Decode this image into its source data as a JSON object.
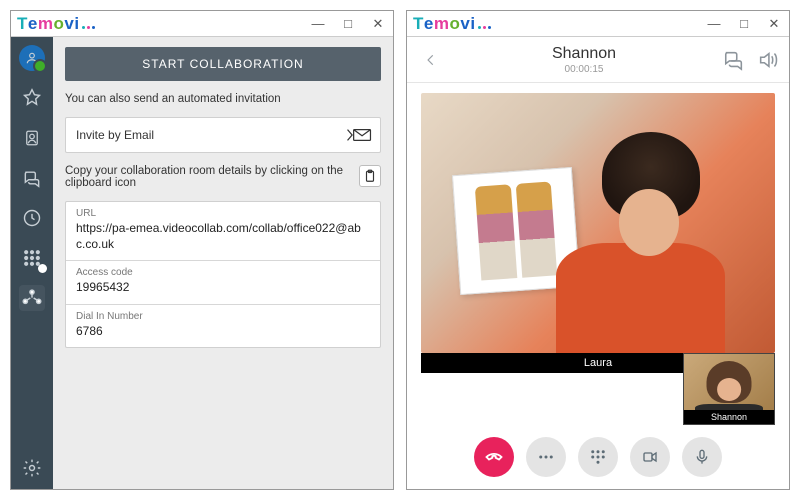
{
  "brand": {
    "t": "T",
    "e": "e",
    "m": "m",
    "o": "o",
    "vi": "vi"
  },
  "windowControls": {
    "minimize": "—",
    "maximize": "□",
    "close": "✕"
  },
  "collab": {
    "startButton": "START COLLABORATION",
    "inviteHint": "You can also send an automated invitation",
    "inviteByEmailLabel": "Invite by Email",
    "copyHint": "Copy your collaboration room details by clicking on the clipboard icon",
    "urlLabel": "URL",
    "urlValue": "https://pa-emea.videocollab.com/collab/office022@abc.co.uk",
    "accessCodeLabel": "Access code",
    "accessCodeValue": "19965432",
    "dialInLabel": "Dial In Number",
    "dialInValue": "6786"
  },
  "sidebar": {
    "items": [
      {
        "name": "avatar-status"
      },
      {
        "name": "favorites"
      },
      {
        "name": "contacts"
      },
      {
        "name": "chats"
      },
      {
        "name": "history"
      },
      {
        "name": "dialpad"
      },
      {
        "name": "collaboration"
      }
    ],
    "footer": {
      "name": "settings"
    }
  },
  "call": {
    "remoteName": "Shannon",
    "duration": "00:00:15",
    "mainParticipantLabel": "Laura",
    "pipParticipantLabel": "Shannon",
    "controls": {
      "hangup": "hangup",
      "more": "more",
      "dialpad": "dialpad",
      "video": "video",
      "mic": "mic"
    }
  }
}
